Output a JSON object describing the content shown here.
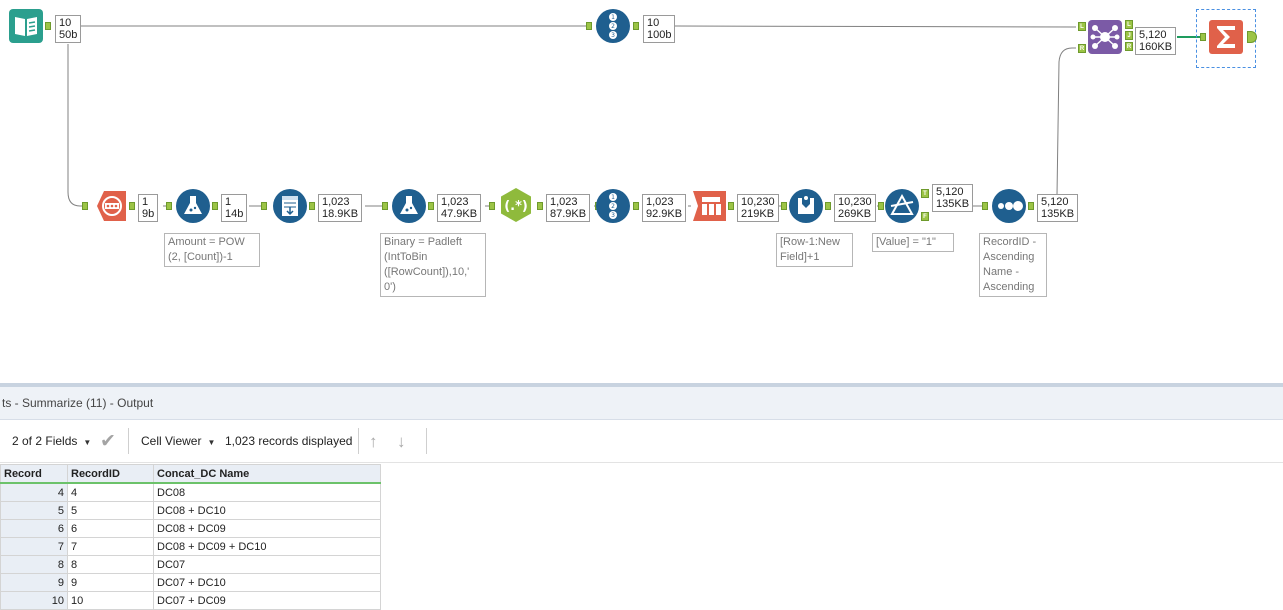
{
  "workflow": {
    "badges": {
      "input": [
        "10",
        "50b"
      ],
      "recordid_top": [
        "10",
        "100b"
      ],
      "join": [
        "5,120",
        "160KB"
      ],
      "generate_rows": [
        "1",
        "9b"
      ],
      "formula1": [
        "1",
        "14b"
      ],
      "append": [
        "1,023",
        "18.9KB"
      ],
      "formula2": [
        "1,023",
        "47.9KB"
      ],
      "regex": [
        "1,023",
        "87.9KB"
      ],
      "recordid2": [
        "1,023",
        "92.9KB"
      ],
      "text_to_columns": [
        "10,230",
        "219KB"
      ],
      "multirow": [
        "10,230",
        "269KB"
      ],
      "filter": [
        "5,120",
        "135KB"
      ],
      "sort": [
        "5,120",
        "135KB"
      ]
    },
    "annotations": {
      "formula1": [
        "Amount = POW",
        "(2, [Count])-1"
      ],
      "formula2": [
        "Binary = Padleft",
        "(IntToBin",
        "([RowCount]),10,'",
        "0')"
      ],
      "multirow": [
        "[Row-1:New",
        "Field]+1"
      ],
      "filter": [
        "[Value] = \"1\""
      ],
      "sort": [
        "RecordID -",
        "Ascending",
        "Name -",
        "Ascending"
      ]
    },
    "anchor_labels": {
      "join_left": "L",
      "join_right": "R",
      "join_out_left": "L",
      "join_out_join": "J",
      "join_out_right": "R",
      "filter_true": "T",
      "filter_false": "F"
    },
    "icons": {
      "input": "book-input-icon",
      "recordid": "record-id-icon",
      "join": "join-icon",
      "summarize": "summarize-sigma-icon",
      "generate_rows": "generate-rows-icon",
      "formula": "formula-flask-icon",
      "append": "append-fields-icon",
      "regex": "regex-icon",
      "text_to_columns": "text-to-columns-icon",
      "multirow": "multi-row-formula-icon",
      "filter": "filter-icon",
      "sort": "sort-icon"
    },
    "colors": {
      "input_tool": "#2b9f8e",
      "blue_tool": "#1f5f8f",
      "orange_tool": "#e0614a",
      "purple_tool": "#7b5aa6",
      "regex_tool": "#8fba3c",
      "anchor": "#9cc446",
      "wire": "#808080"
    }
  },
  "results": {
    "title": "ts - Summarize (11) - Output",
    "fields_label": "2 of 2 Fields",
    "viewer_label": "Cell Viewer",
    "records_label": "1,023 records displayed",
    "columns": [
      "Record",
      "RecordID",
      "Concat_DC Name"
    ],
    "rows": [
      [
        "4",
        "4",
        "DC08"
      ],
      [
        "5",
        "5",
        "DC08 + DC10"
      ],
      [
        "6",
        "6",
        "DC08 + DC09"
      ],
      [
        "7",
        "7",
        "DC08 + DC09 + DC10"
      ],
      [
        "8",
        "8",
        "DC07"
      ],
      [
        "9",
        "9",
        "DC07 + DC10"
      ],
      [
        "10",
        "10",
        "DC07 + DC09"
      ]
    ]
  }
}
